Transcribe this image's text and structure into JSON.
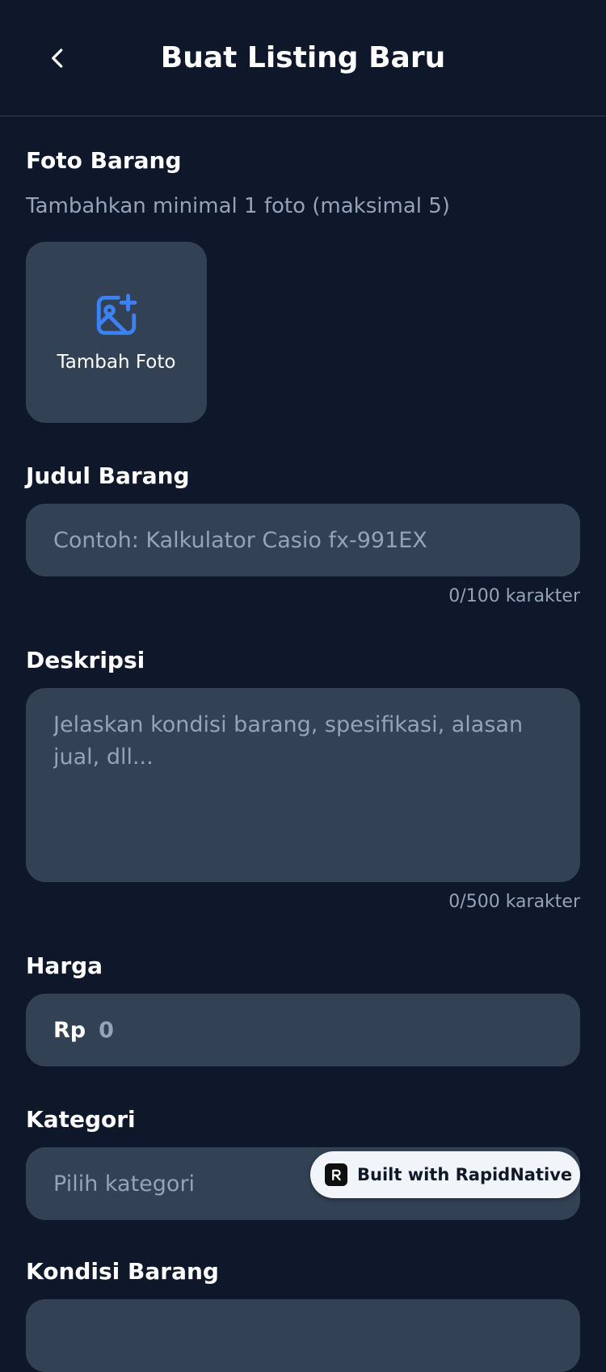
{
  "header": {
    "title": "Buat Listing Baru",
    "back_icon": "chevron-left-icon"
  },
  "photo": {
    "label": "Foto Barang",
    "hint": "Tambahkan minimal 1 foto (maksimal 5)",
    "add_label": "Tambah Foto",
    "add_icon": "image-plus-icon",
    "accent": "#3b82f6"
  },
  "title_field": {
    "label": "Judul Barang",
    "placeholder": "Contoh: Kalkulator Casio fx-991EX",
    "value": "",
    "counter": "0/100 karakter"
  },
  "description_field": {
    "label": "Deskripsi",
    "placeholder": "Jelaskan kondisi barang, spesifikasi, alasan jual, dll...",
    "value": "",
    "counter": "0/500 karakter"
  },
  "price_field": {
    "label": "Harga",
    "prefix": "Rp",
    "placeholder": "0",
    "value": ""
  },
  "category_field": {
    "label": "Kategori",
    "placeholder": "Pilih kategori"
  },
  "condition_field": {
    "label": "Kondisi Barang"
  },
  "badge": {
    "text": "Built with RapidNative"
  },
  "colors": {
    "background": "#0f172a",
    "surface": "#334155",
    "muted_text": "#94a3b8",
    "accent": "#3b82f6"
  }
}
